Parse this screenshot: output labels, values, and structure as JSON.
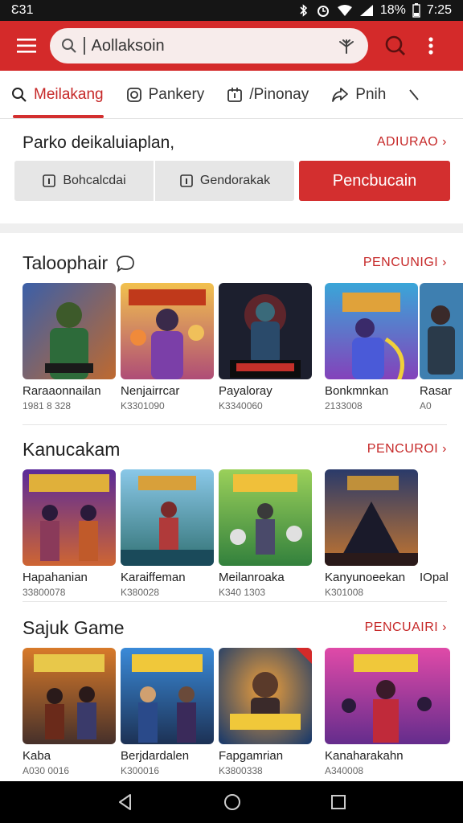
{
  "status": {
    "left": "Ɛ31",
    "battery": "18%",
    "time": "7:25"
  },
  "search": {
    "value": "Aollaksoin"
  },
  "tabs": [
    "Meilakang",
    "Pankery",
    "/Pinonay",
    "Pnih"
  ],
  "filter": {
    "heading": "Parko deikaluiaplan,",
    "link": "ADIURAO",
    "chips": [
      "Bohcalcdai",
      "Gendorakak"
    ],
    "button": "Pencbucain"
  },
  "sections": [
    {
      "title": "Taloophair",
      "link": "PENCUNIGI",
      "cards": [
        {
          "title": "Raraaonnailan",
          "sub": "1981 8 328"
        },
        {
          "title": "Nenjairrcar",
          "sub": "K3301090"
        },
        {
          "title": "Payaloray",
          "sub": "K3340060"
        },
        {
          "title": "Bonkmnkan",
          "sub": "2133008"
        },
        {
          "title": "Rasar",
          "sub": "A0"
        }
      ]
    },
    {
      "title": "Kanucakam",
      "link": "PENCUROI",
      "cards": [
        {
          "title": "Hapahanian",
          "sub": "33800078"
        },
        {
          "title": "Karaiffeman",
          "sub": "K380028"
        },
        {
          "title": "Meilanroaka",
          "sub": "K340 1303"
        },
        {
          "title": "Kanyunoeekan",
          "sub": "K301008"
        },
        {
          "title": "IOpal",
          "sub": ""
        }
      ]
    },
    {
      "title": "Sajuk Game",
      "link": "PENCUAIRI",
      "cards": [
        {
          "title": "Kaba",
          "sub": "A030 0016"
        },
        {
          "title": "Berjdardalen",
          "sub": "K300016"
        },
        {
          "title": "Fapgamrian",
          "sub": "K3800338"
        },
        {
          "title": "Kanaharakahn",
          "sub": "A340008"
        }
      ]
    }
  ],
  "colors": {
    "accent": "#d42a2a",
    "link": "#c62828"
  }
}
